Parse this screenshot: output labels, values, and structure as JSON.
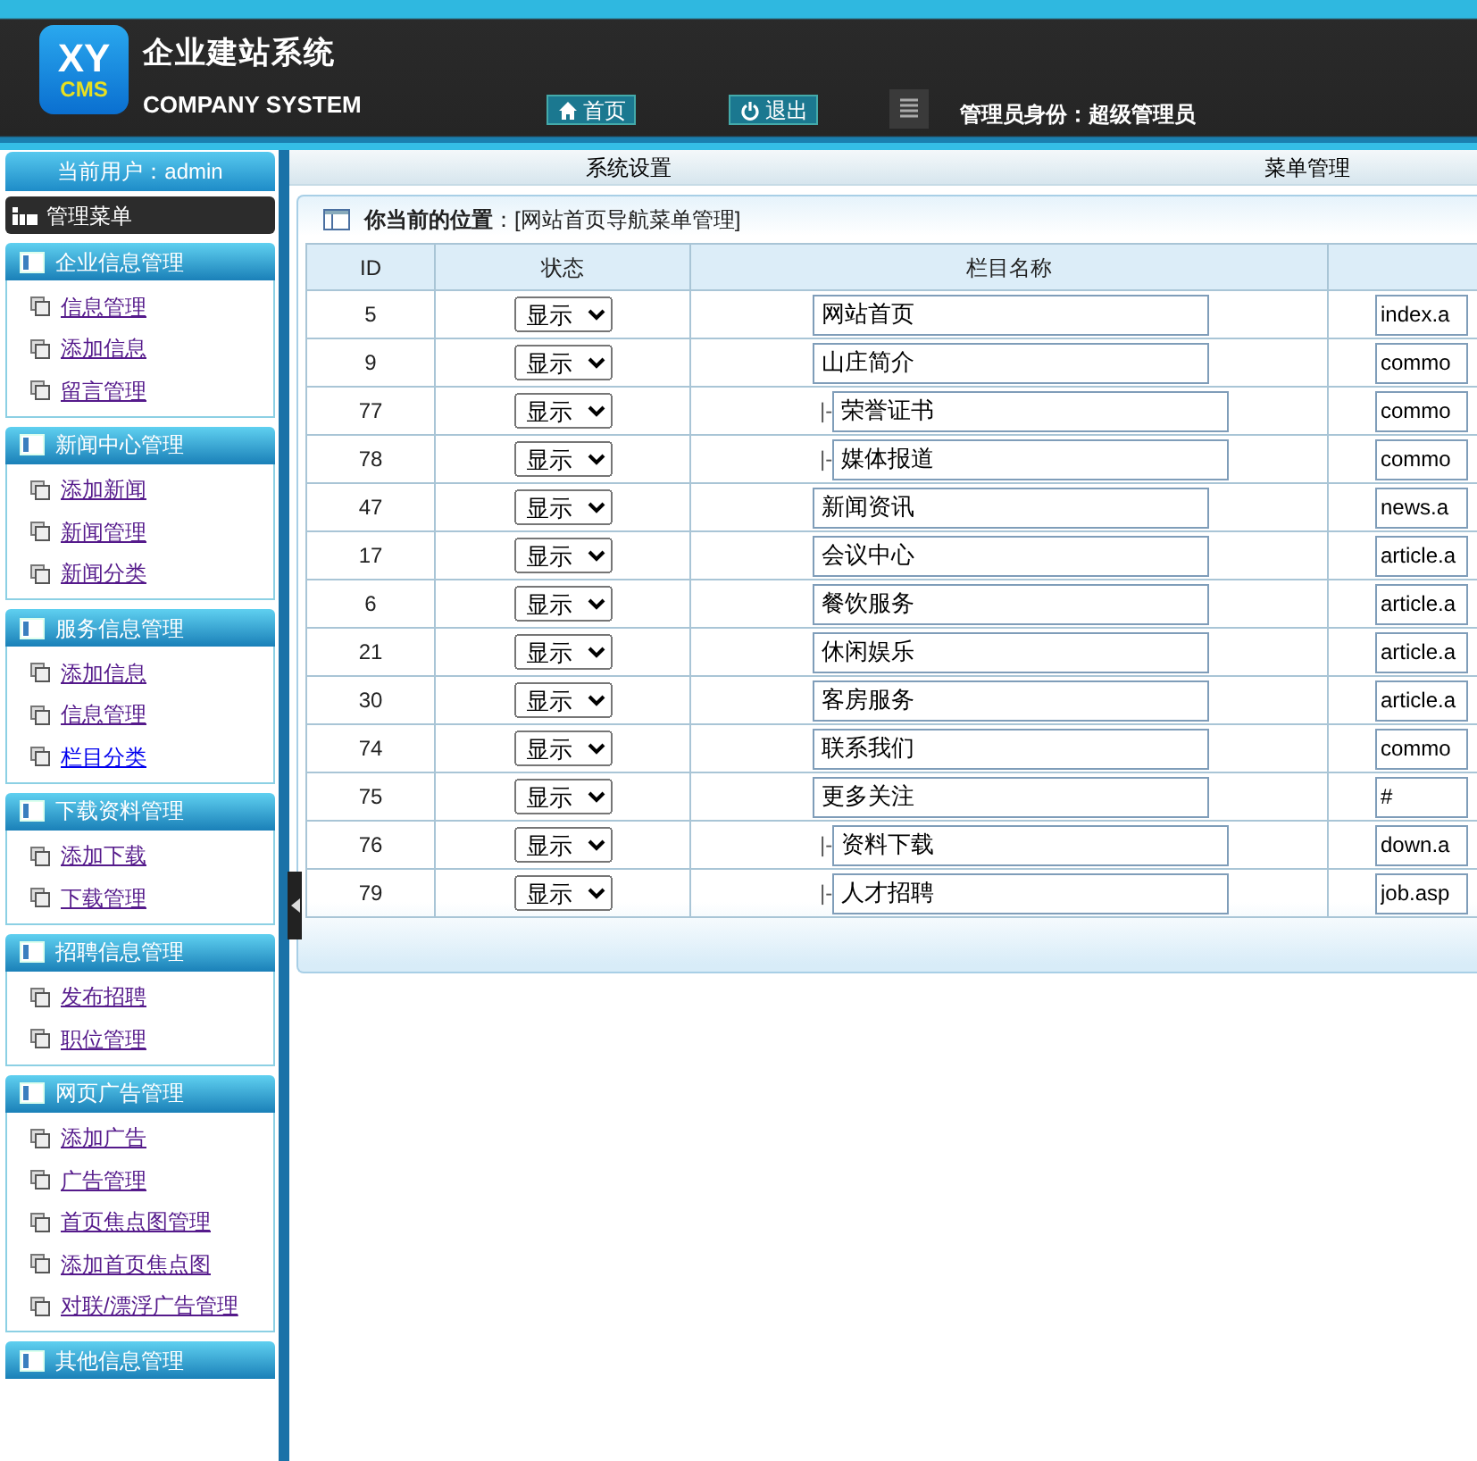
{
  "header": {
    "logo_top": "XY",
    "logo_bottom": "CMS",
    "title": "企业建站系统",
    "subtitle": "COMPANY SYSTEM",
    "buttons": [
      {
        "label": "首页",
        "kind": "home"
      },
      {
        "label": "退出",
        "kind": "power"
      }
    ],
    "role": "管理员身份：超级管理员"
  },
  "user": {
    "label": "当前用户：admin"
  },
  "menu_title": "管理菜单",
  "sidebar": [
    {
      "title": "企业信息管理",
      "items": [
        {
          "label": "信息管理",
          "visited": true
        },
        {
          "label": "添加信息",
          "visited": true
        },
        {
          "label": "留言管理",
          "visited": true
        }
      ]
    },
    {
      "title": "新闻中心管理",
      "items": [
        {
          "label": "添加新闻",
          "visited": true
        },
        {
          "label": "新闻管理",
          "visited": true
        },
        {
          "label": "新闻分类",
          "visited": true
        }
      ]
    },
    {
      "title": "服务信息管理",
      "items": [
        {
          "label": "添加信息",
          "visited": true
        },
        {
          "label": "信息管理",
          "visited": true
        },
        {
          "label": "栏目分类",
          "visited": false
        }
      ]
    },
    {
      "title": "下载资料管理",
      "items": [
        {
          "label": "添加下载",
          "visited": true
        },
        {
          "label": "下载管理",
          "visited": true
        }
      ]
    },
    {
      "title": "招聘信息管理",
      "items": [
        {
          "label": "发布招聘",
          "visited": true
        },
        {
          "label": "职位管理",
          "visited": true
        }
      ]
    },
    {
      "title": "网页广告管理",
      "items": [
        {
          "label": "添加广告",
          "visited": true
        },
        {
          "label": "广告管理",
          "visited": true
        },
        {
          "label": "首页焦点图管理",
          "visited": true
        },
        {
          "label": "添加首页焦点图",
          "visited": true
        },
        {
          "label": "对联/漂浮广告管理",
          "visited": true
        }
      ]
    },
    {
      "title": "其他信息管理"
    }
  ],
  "tabs": [
    "系统设置",
    "菜单管理"
  ],
  "breadcrumb": {
    "label": "你当前的位置",
    "path": "：[网站首页导航菜单管理]"
  },
  "table": {
    "columns": [
      "ID",
      "状态",
      "栏目名称"
    ],
    "rows": [
      {
        "id": "5",
        "status": "显示",
        "name": "网站首页",
        "link": "index.a"
      },
      {
        "id": "9",
        "status": "显示",
        "name": "山庄简介",
        "link": "commo",
        "children": [
          {
            "id": "77",
            "status": "显示",
            "prefix": "|-",
            "name": "荣誉证书",
            "link": "commo"
          },
          {
            "id": "78",
            "status": "显示",
            "prefix": "|-",
            "name": "媒体报道",
            "link": "commo"
          }
        ]
      },
      {
        "id": "47",
        "status": "显示",
        "name": "新闻资讯",
        "link": "news.a"
      },
      {
        "id": "17",
        "status": "显示",
        "name": "会议中心",
        "link": "article.a"
      },
      {
        "id": "6",
        "status": "显示",
        "name": "餐饮服务",
        "link": "article.a"
      },
      {
        "id": "21",
        "status": "显示",
        "name": "休闲娱乐",
        "link": "article.a"
      },
      {
        "id": "30",
        "status": "显示",
        "name": "客房服务",
        "link": "article.a"
      },
      {
        "id": "74",
        "status": "显示",
        "name": "联系我们",
        "link": "commo"
      },
      {
        "id": "75",
        "status": "显示",
        "name": "更多关注",
        "link": "#",
        "children": [
          {
            "id": "76",
            "status": "显示",
            "prefix": "|-",
            "name": "资料下载",
            "link": "down.a"
          },
          {
            "id": "79",
            "status": "显示",
            "prefix": "|-",
            "name": "人才招聘",
            "link": "job.asp"
          }
        ]
      }
    ]
  }
}
